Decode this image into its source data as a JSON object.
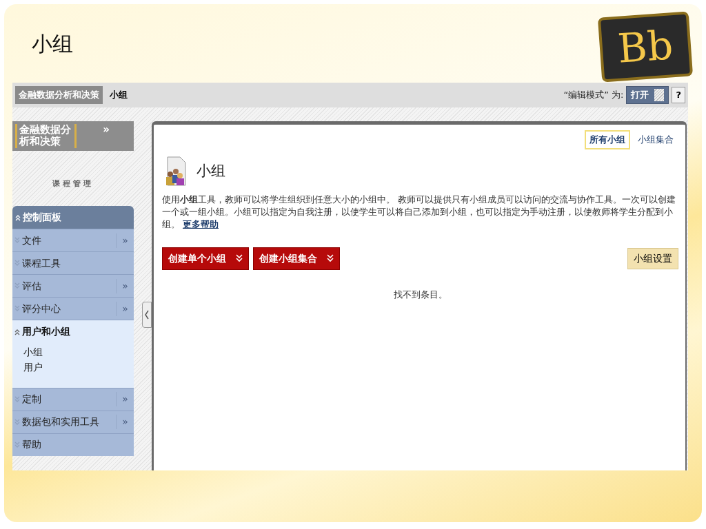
{
  "slide": {
    "title": "小组",
    "logo": "Bb"
  },
  "breadcrumb": [
    {
      "label": "金融数据分析和决策",
      "kind": "course"
    },
    {
      "label": "小组",
      "kind": "page"
    }
  ],
  "edit_mode": {
    "label": "“编辑模式” 为:",
    "value": "打开",
    "on": true,
    "help": "?"
  },
  "course_menu": {
    "title": "金融数据分析和决策",
    "arrow": "»",
    "section_label": "课程管理"
  },
  "control_panel": {
    "title": "控制面板",
    "expanded": true,
    "items": [
      {
        "label": "文件",
        "expanded": false,
        "arrow": "»"
      },
      {
        "label": "课程工具",
        "expanded": false
      },
      {
        "label": "评估",
        "expanded": false,
        "arrow": "»"
      },
      {
        "label": "评分中心",
        "expanded": false,
        "arrow": "»"
      },
      {
        "label": "用户和小组",
        "expanded": true,
        "children": [
          {
            "label": "小组"
          },
          {
            "label": "用户"
          }
        ]
      },
      {
        "label": "定制",
        "expanded": false,
        "arrow": "»"
      },
      {
        "label": "数据包和实用工具",
        "expanded": false,
        "arrow": "»"
      },
      {
        "label": "帮助",
        "expanded": false
      }
    ]
  },
  "tabs": [
    {
      "label": "所有小组",
      "selected": true
    },
    {
      "label": "小组集合",
      "selected": false
    }
  ],
  "page_title": "小组",
  "description": "使用**小组**工具，教师可以将学生组织到任意大小的小组中。 教师可以提供只有小组成员可以访问的交流与协作工具。一次可以创建一个或一组小组。小组可以指定为自我注册，以使学生可以将自己添加到小组，也可以指定为手动注册，以使教师将学生分配到小组。",
  "more_help": "更多帮助",
  "create_buttons": [
    {
      "label": "创建单个小组"
    },
    {
      "label": "创建小组集合"
    }
  ],
  "settings_button": "小组设置",
  "empty_message": "找不到条目。"
}
